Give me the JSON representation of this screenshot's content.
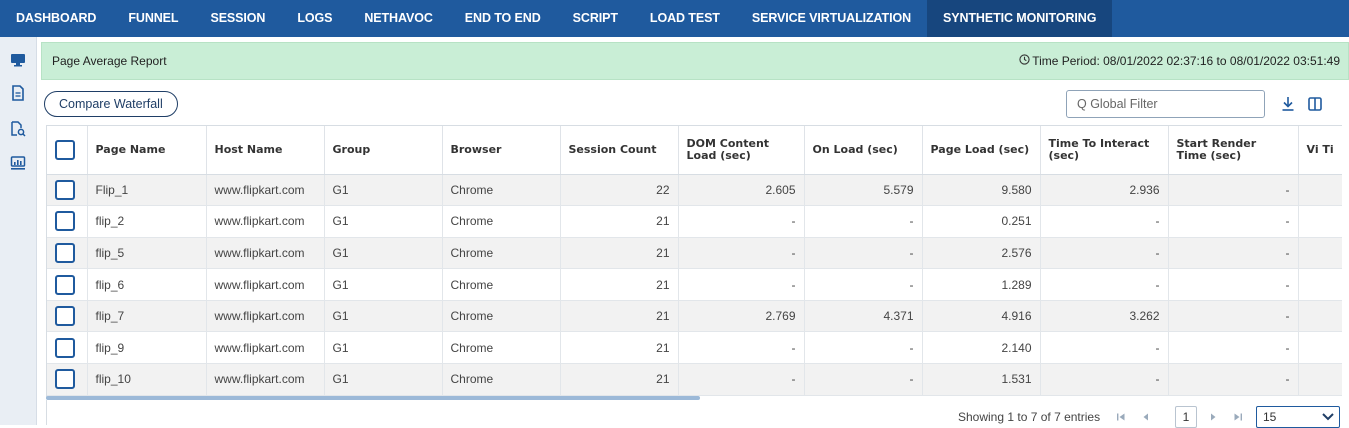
{
  "topnav": {
    "items": [
      "DASHBOARD",
      "FUNNEL",
      "SESSION",
      "LOGS",
      "NETHAVOC",
      "END TO END",
      "SCRIPT",
      "LOAD TEST",
      "SERVICE VIRTUALIZATION",
      "SYNTHETIC MONITORING"
    ],
    "active": "SYNTHETIC MONITORING"
  },
  "sidebar": {
    "icons": [
      "monitor-icon",
      "document-icon",
      "file-search-icon",
      "dashboard-screen-icon"
    ]
  },
  "report": {
    "title": "Page Average Report",
    "time_period": "Time Period: 08/01/2022 02:37:16 to 08/01/2022 03:51:49"
  },
  "toolbar": {
    "compare_label": "Compare Waterfall",
    "filter_placeholder": "Q Global Filter",
    "filter_value": "",
    "icons": [
      "download-icon",
      "columns-icon"
    ]
  },
  "table": {
    "headers": [
      "Page Name",
      "Host Name",
      "Group",
      "Browser",
      "Session Count",
      "DOM Content Load (sec)",
      "On Load (sec)",
      "Page Load (sec)",
      "Time To Interact (sec)",
      "Start Render Time (sec)",
      "Vi Ti"
    ],
    "rows": [
      [
        "Flip_1",
        "www.flipkart.com",
        "G1",
        "Chrome",
        "22",
        "2.605",
        "5.579",
        "9.580",
        "2.936",
        "-"
      ],
      [
        "flip_2",
        "www.flipkart.com",
        "G1",
        "Chrome",
        "21",
        "-",
        "-",
        "0.251",
        "-",
        "-"
      ],
      [
        "flip_5",
        "www.flipkart.com",
        "G1",
        "Chrome",
        "21",
        "-",
        "-",
        "2.576",
        "-",
        "-"
      ],
      [
        "flip_6",
        "www.flipkart.com",
        "G1",
        "Chrome",
        "21",
        "-",
        "-",
        "1.289",
        "-",
        "-"
      ],
      [
        "flip_7",
        "www.flipkart.com",
        "G1",
        "Chrome",
        "21",
        "2.769",
        "4.371",
        "4.916",
        "3.262",
        "-"
      ],
      [
        "flip_9",
        "www.flipkart.com",
        "G1",
        "Chrome",
        "21",
        "-",
        "-",
        "2.140",
        "-",
        "-"
      ],
      [
        "flip_10",
        "www.flipkart.com",
        "G1",
        "Chrome",
        "21",
        "-",
        "-",
        "1.531",
        "-",
        "-"
      ]
    ]
  },
  "pagination": {
    "entries_text": "Showing 1 to 7 of 7 entries",
    "current_page": "1",
    "page_size": "15"
  },
  "colors": {
    "nav_bg": "#1f5a9e",
    "nav_active_bg": "#17467e",
    "header_bg": "#c9eed6",
    "accent": "#1f5a9e"
  }
}
